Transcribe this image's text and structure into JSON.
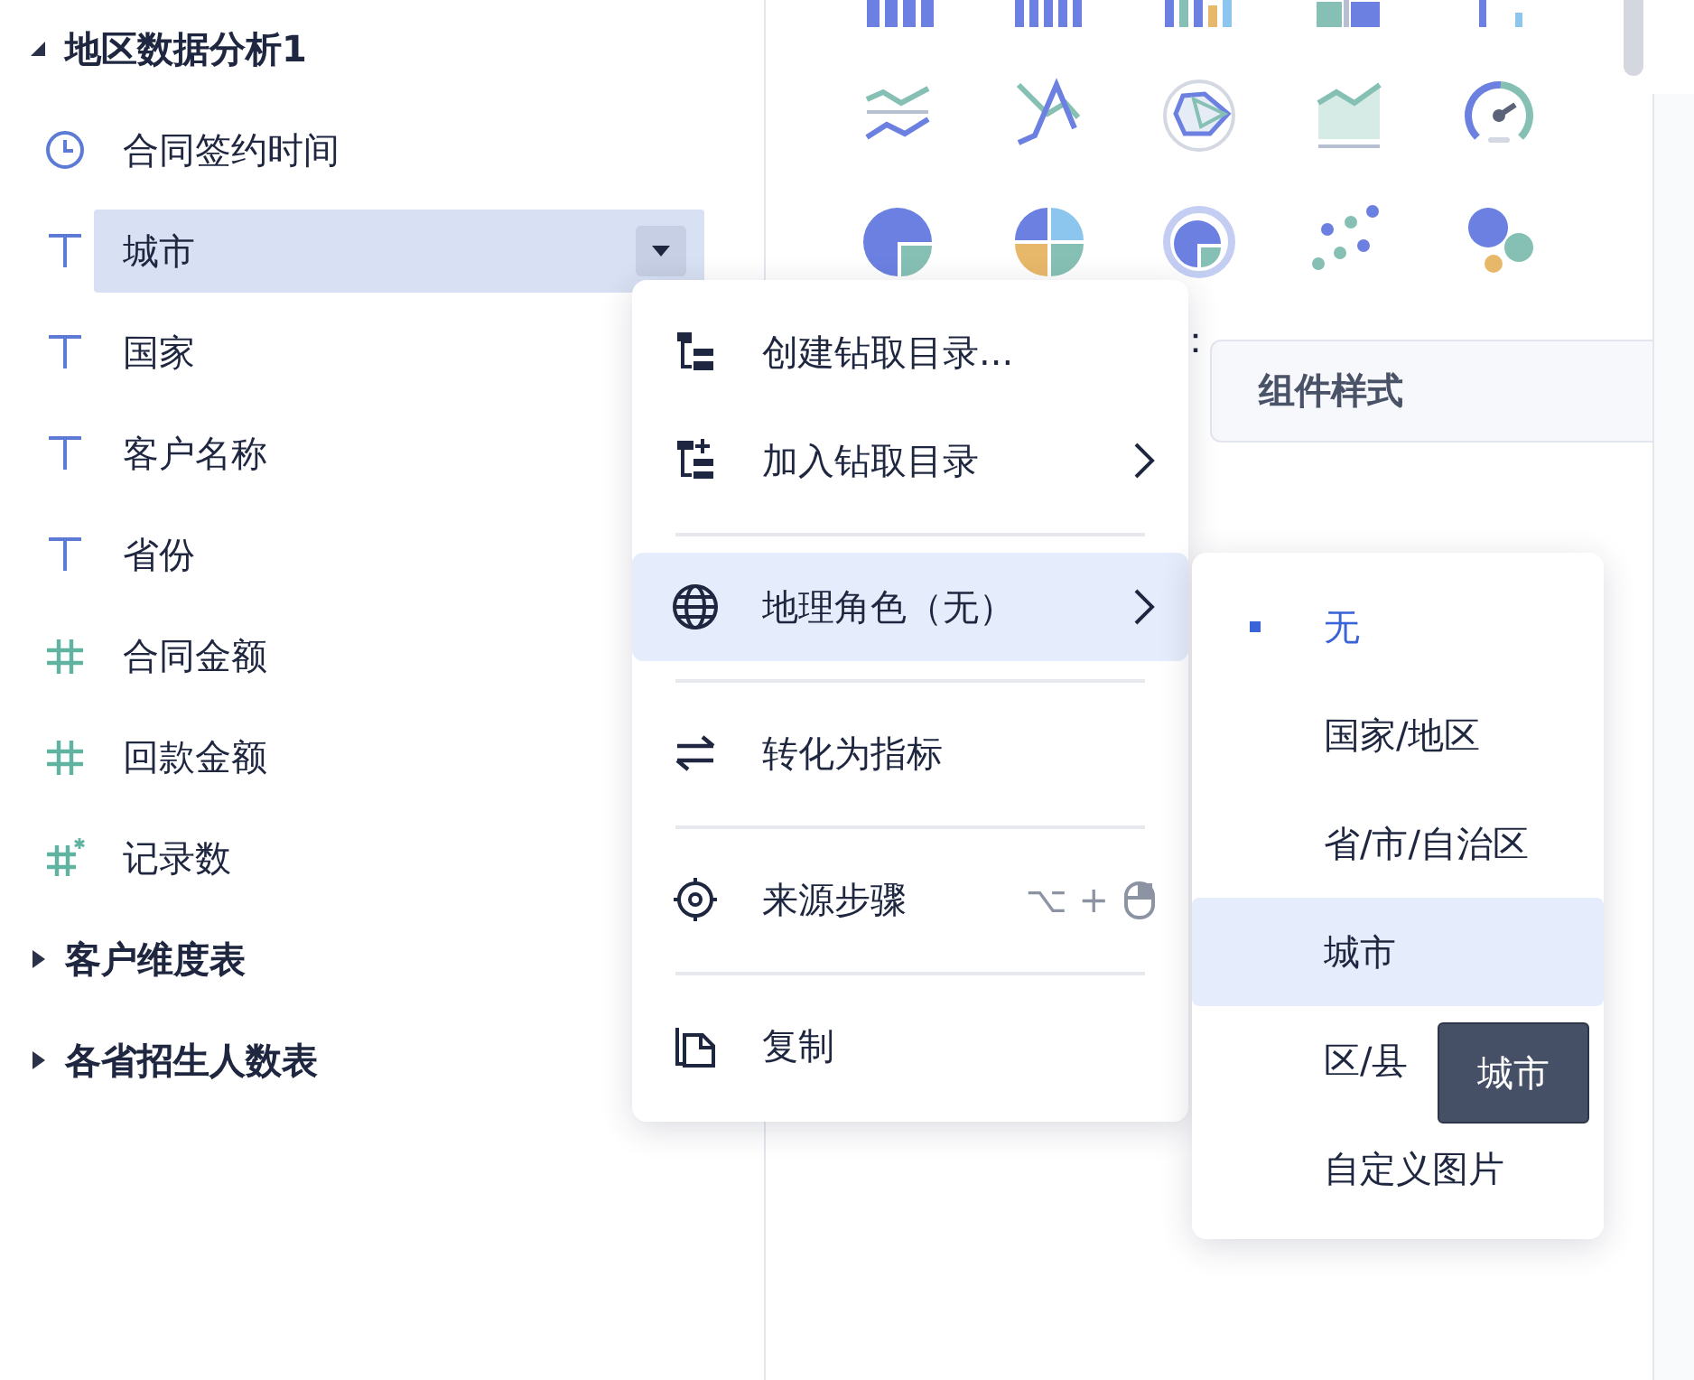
{
  "tree": [
    {
      "label": "地区数据分析1",
      "expanded": true,
      "children": [
        {
          "label": "合同签约时间",
          "kind": "date",
          "selected": false
        },
        {
          "label": "城市",
          "kind": "text",
          "selected": true
        },
        {
          "label": "国家",
          "kind": "text",
          "selected": false
        },
        {
          "label": "客户名称",
          "kind": "text",
          "selected": false
        },
        {
          "label": "省份",
          "kind": "text",
          "selected": false
        },
        {
          "label": "合同金额",
          "kind": "number",
          "selected": false
        },
        {
          "label": "回款金额",
          "kind": "number",
          "selected": false
        },
        {
          "label": "记录数",
          "kind": "count",
          "selected": false
        }
      ]
    },
    {
      "label": "客户维度表",
      "expanded": false
    },
    {
      "label": "各省招生人数表",
      "expanded": false
    }
  ],
  "field_label_colon": "：",
  "style_tab": {
    "label": "组件样式"
  },
  "context_menu": {
    "items": [
      {
        "label": "创建钻取目录...",
        "divider_before": false,
        "highlighted": false,
        "submenu": false
      },
      {
        "label": "加入钻取目录",
        "divider_before": false,
        "highlighted": false,
        "submenu": true
      },
      {
        "label": "地理角色（无）",
        "divider_before": true,
        "highlighted": true,
        "submenu": true
      },
      {
        "label": "转化为指标",
        "divider_before": true,
        "highlighted": false,
        "submenu": false
      },
      {
        "label": "来源步骤",
        "divider_before": true,
        "highlighted": false,
        "submenu": false,
        "shortcut": "⌥ +"
      },
      {
        "label": "复制",
        "divider_before": true,
        "highlighted": false,
        "submenu": false
      }
    ]
  },
  "geo_submenu": {
    "items": [
      {
        "label": "无",
        "selected": true,
        "highlighted": false
      },
      {
        "label": "国家/地区",
        "selected": false,
        "highlighted": false
      },
      {
        "label": "省/市/自治区",
        "selected": false,
        "highlighted": false
      },
      {
        "label": "城市",
        "selected": false,
        "highlighted": true
      },
      {
        "label": "区/县",
        "selected": false,
        "highlighted": false
      },
      {
        "label": "自定义图片",
        "selected": false,
        "highlighted": false
      }
    ]
  },
  "tooltip": {
    "text": "城市"
  }
}
